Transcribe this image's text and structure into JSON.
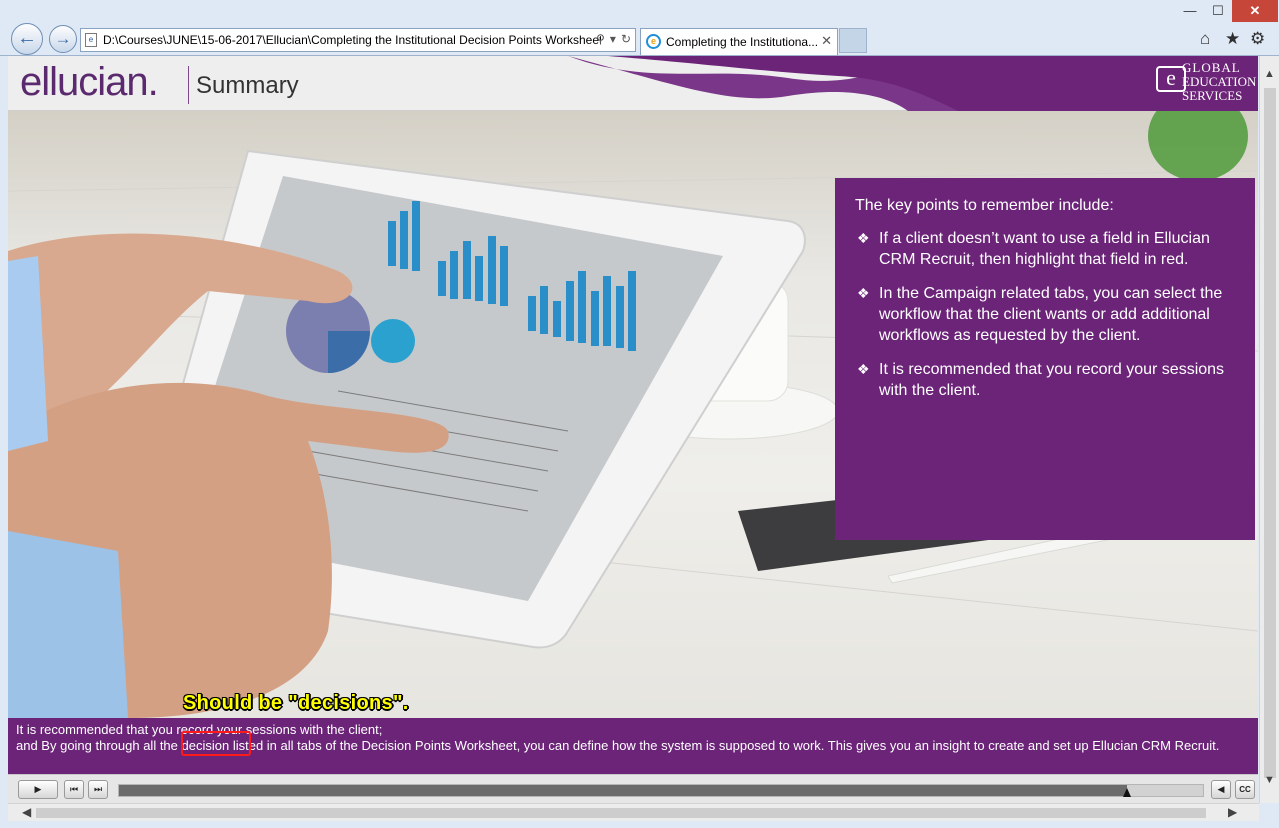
{
  "browser": {
    "window_buttons": {
      "minimize": "—",
      "maximize": "☐",
      "close": "✕"
    },
    "address_url": "D:\\Courses\\JUNE\\15-06-2017\\Ellucian\\Completing the Institutional Decision Points Worksheet",
    "tab_title": "Completing the Institutiona...",
    "tab_close": "✕",
    "icons": [
      "back-arrow-icon",
      "forward-arrow-icon",
      "page-icon",
      "search-icon",
      "dropdown-icon",
      "refresh-icon",
      "ie-icon",
      "home-icon",
      "favorites-star-icon",
      "settings-gear-icon"
    ]
  },
  "header": {
    "logo": "ellucian.",
    "title": "Summary",
    "partner_logo": {
      "letter": "e",
      "line1": "GLOBAL",
      "line2": "EDUCATION",
      "line3": "SERVICES"
    }
  },
  "info_box": {
    "intro": "The key points to remember include:",
    "points": [
      "If a client doesn’t want to use a field in Ellucian CRM Recruit, then highlight that field in red.",
      "In the Campaign related tabs, you can select the workflow that the client wants or add additional workflows as requested by the client.",
      "It is recommended that you record your sessions with the client."
    ]
  },
  "annotation": "Should be \"decisions\".",
  "caption": {
    "line1": "It is recommended that you record your sessions with the client;",
    "line2_before": "and By going through all the ",
    "line2_word": "decision",
    "line2_after": " listed in all tabs of the Decision Points Worksheet, you can define how the system is supposed to work. This gives you an insight to create and set up Ellucian CRM Recruit."
  },
  "player": {
    "progress": 0.93,
    "cc_label": "CC"
  },
  "colors": {
    "brand_purple": "#6c2479",
    "annotation_yellow": "#ffff00",
    "highlight_red": "#ff1a1a"
  }
}
